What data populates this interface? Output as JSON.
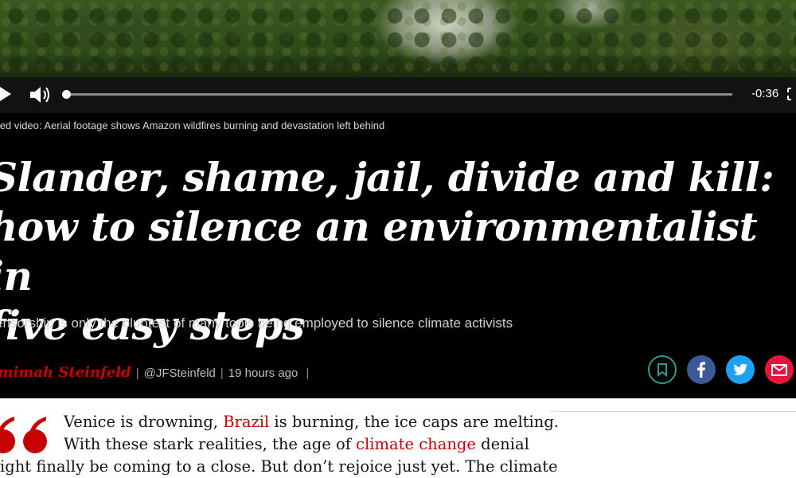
{
  "video": {
    "time_remaining": "-0:36",
    "progress": 0.0,
    "caption": "lated video: Aerial footage shows Amazon wildfires burning and devastation left behind"
  },
  "article": {
    "headline_lines": [
      "Slander, shame, jail, divide and kill:",
      "how to silence an environmentalist in",
      "five easy steps"
    ],
    "standfirst": "ensorship is only the bluntest of many tools being employed to silence climate activists",
    "byline": {
      "author": "emimah Steinfeld",
      "handle": "@JFSteinfeld",
      "time": "19 hours ago",
      "separator": "|"
    },
    "body": {
      "line1_pre": "Venice is drowning, ",
      "line1_link": "Brazil",
      "line1_post": " is burning, the ice caps are melting.",
      "line2_pre": "With these stark realities, the age of ",
      "line2_link": "climate change",
      "line2_post": " denial",
      "line3": "ight finally be coming to a close. But don’t rejoice just yet. The climate"
    }
  },
  "share": {
    "icons": [
      "bookmark-icon",
      "facebook-icon",
      "twitter-icon",
      "email-icon"
    ]
  },
  "colors": {
    "accent_red": "#c70000",
    "bookmark_teal": "#2a9d8f",
    "facebook": "#3b5998",
    "twitter": "#1da1f2",
    "email": "#e8153a"
  }
}
